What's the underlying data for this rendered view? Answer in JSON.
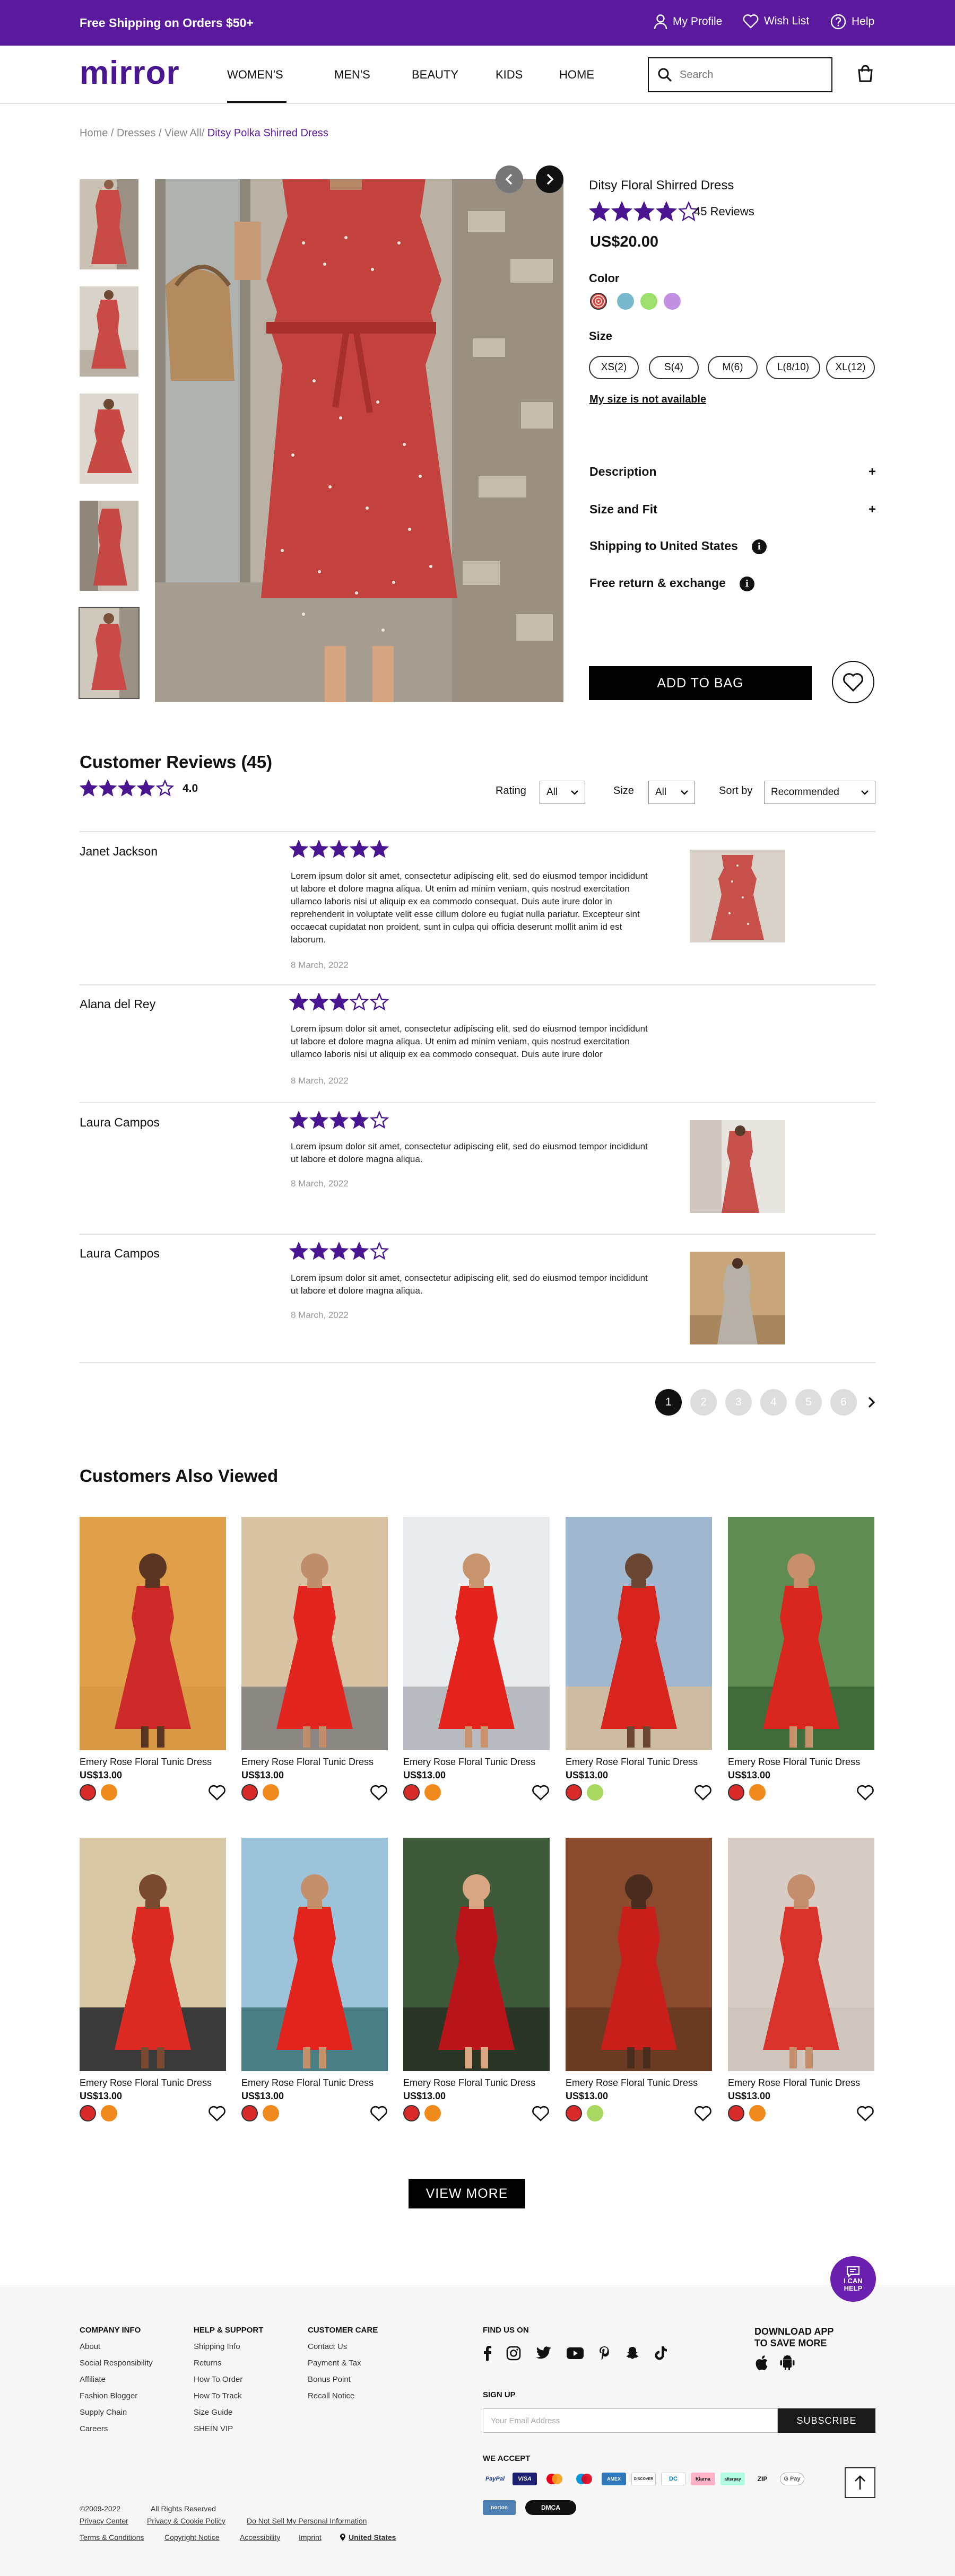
{
  "topbar": {
    "shipping": "Free Shipping on Orders $50+",
    "profile": "My Profile",
    "wishlist": "Wish List",
    "help": "Help"
  },
  "header": {
    "logo": "mirror",
    "nav": [
      "WOMEN'S",
      "MEN'S",
      "BEAUTY",
      "KIDS",
      "HOME"
    ],
    "search_placeholder": "Search"
  },
  "breadcrumb": {
    "items": [
      "Home",
      "Dresses",
      "View All"
    ],
    "current": "Ditsy Polka Shirred Dress"
  },
  "product": {
    "name": "Ditsy Floral Shirred Dress",
    "rating": 4,
    "reviews_label": "45 Reviews",
    "price": "US$20.00",
    "color_label": "Color",
    "colors": [
      "#e05a52",
      "#7ab8cc",
      "#9ee06e",
      "#c190e0"
    ],
    "size_label": "Size",
    "sizes": [
      "XS(2)",
      "S(4)",
      "M(6)",
      "L(8/10)",
      "XL(12)"
    ],
    "size_unavailable": "My size is not available",
    "accordion": [
      {
        "label": "Description",
        "type": "plus"
      },
      {
        "label": "Size and Fit",
        "type": "plus"
      },
      {
        "label": "Shipping to United States",
        "type": "info"
      },
      {
        "label": "Free return & exchange",
        "type": "info"
      }
    ],
    "add_to_bag": "ADD TO BAG"
  },
  "reviews": {
    "title": "Customer Reviews (45)",
    "average": "4.0",
    "filters": {
      "rating_label": "Rating",
      "rating_value": "All",
      "size_label": "Size",
      "size_value": "All",
      "sort_label": "Sort by",
      "sort_value": "Recommended"
    },
    "items": [
      {
        "name": "Janet Jackson",
        "stars": 5,
        "text": "Lorem ipsum dolor sit amet, consectetur adipiscing elit, sed do eiusmod tempor incididunt ut labore et dolore magna aliqua. Ut enim ad minim veniam, quis nostrud exercitation ullamco laboris nisi ut aliquip ex ea commodo consequat. Duis aute irure dolor in reprehenderit in voluptate velit esse cillum dolore eu fugiat nulla pariatur. Excepteur sint occaecat cupidatat non proident, sunt in culpa qui officia deserunt mollit anim id est laborum.",
        "date": "8 March, 2022"
      },
      {
        "name": "Alana del Rey",
        "stars": 3,
        "text": "Lorem ipsum dolor sit amet, consectetur adipiscing elit, sed do eiusmod tempor incididunt ut labore et dolore magna aliqua. Ut enim ad minim veniam, quis nostrud exercitation ullamco laboris nisi ut aliquip ex ea commodo consequat. Duis aute irure dolor",
        "date": "8 March, 2022"
      },
      {
        "name": "Laura Campos",
        "stars": 4,
        "text": "Lorem ipsum dolor sit amet, consectetur adipiscing elit, sed do eiusmod tempor incididunt ut labore et dolore magna aliqua.",
        "date": "8 March, 2022"
      },
      {
        "name": "Laura Campos",
        "stars": 4,
        "text": "Lorem ipsum dolor sit amet, consectetur adipiscing elit, sed do eiusmod tempor incididunt ut labore et dolore magna aliqua.",
        "date": "8 March, 2022"
      }
    ],
    "pages": [
      "1",
      "2",
      "3",
      "4",
      "5",
      "6"
    ],
    "current_page": "1"
  },
  "also_viewed": {
    "title": "Customers Also Viewed",
    "items": [
      {
        "name": "Emery Rose Floral Tunic Dress",
        "price": "US$13.00"
      },
      {
        "name": "Emery Rose Floral Tunic Dress",
        "price": "US$13.00"
      },
      {
        "name": "Emery Rose Floral Tunic Dress",
        "price": "US$13.00"
      },
      {
        "name": "Emery Rose Floral Tunic Dress",
        "price": "US$13.00"
      },
      {
        "name": "Emery Rose Floral Tunic Dress",
        "price": "US$13.00"
      },
      {
        "name": "Emery Rose Floral Tunic Dress",
        "price": "US$13.00"
      },
      {
        "name": "Emery Rose Floral Tunic Dress",
        "price": "US$13.00"
      },
      {
        "name": "Emery Rose Floral Tunic Dress",
        "price": "US$13.00"
      },
      {
        "name": "Emery Rose Floral Tunic Dress",
        "price": "US$13.00"
      },
      {
        "name": "Emery Rose Floral Tunic Dress",
        "price": "US$13.00"
      }
    ],
    "view_more": "VIEW MORE"
  },
  "help_button": {
    "line1": "I CAN",
    "line2": "HELP"
  },
  "footer": {
    "company": {
      "title": "COMPANY INFO",
      "links": [
        "About",
        "Social Responsibility",
        "Affiliate",
        "Fashion Blogger",
        "Supply Chain",
        "Careers"
      ]
    },
    "support": {
      "title": "HELP & SUPPORT",
      "links": [
        "Shipping Info",
        "Returns",
        "How To Order",
        "How To Track",
        "Size Guide",
        "SHEIN VIP"
      ]
    },
    "care": {
      "title": "CUSTOMER CARE",
      "links": [
        "Contact Us",
        "Payment & Tax",
        "Bonus Point",
        "Recall Notice"
      ]
    },
    "find_us": "FIND US ON",
    "app_line1": "DOWNLOAD APP",
    "app_line2": "TO SAVE MORE",
    "signup": "SIGN UP",
    "email_placeholder": "Your Email Address",
    "subscribe": "SUBSCRIBE",
    "we_accept": "WE ACCEPT",
    "payments": [
      "PayPal",
      "VISA",
      "mc",
      "maestro",
      "AMEX",
      "DISCOVER",
      "DC",
      "Klarna",
      "afterpay",
      "ZIP",
      "G Pay"
    ],
    "badge1": "norton",
    "badge2": "DMCA",
    "copyright": "©2009-2022",
    "rights": "All Rights Reserved",
    "legal_links": [
      "Privacy Center",
      "Privacy & Cookie Policy",
      "Do Not Sell My Personal Information",
      "Terms & Conditions",
      "Copyright Notice",
      "Accessibility",
      "Imprint"
    ],
    "region": "United States"
  }
}
